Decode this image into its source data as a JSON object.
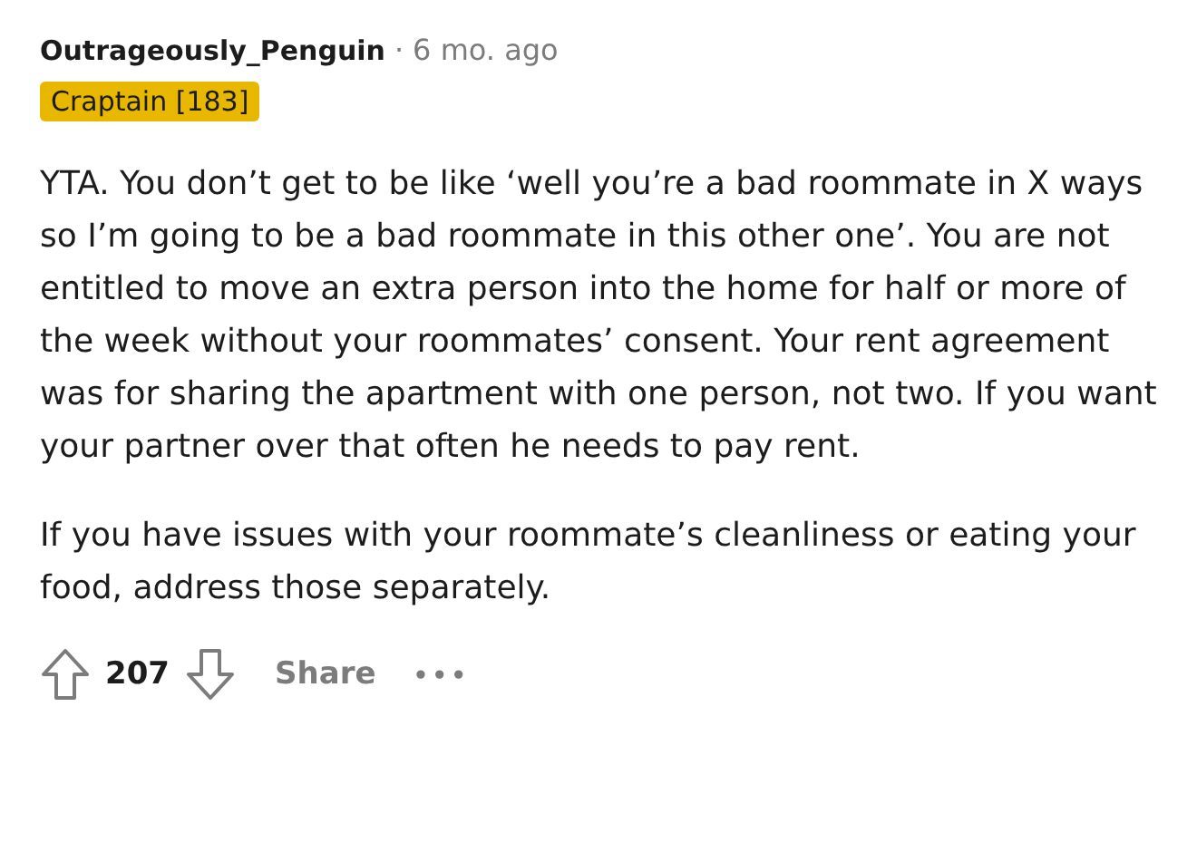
{
  "comment": {
    "author": "Outrageously_Penguin",
    "separator": "·",
    "time": "6 mo. ago",
    "flair": "Craptain [183]",
    "paragraphs": [
      "YTA. You don’t get to be like ‘well you’re a bad roommate in X ways so I’m going to be a bad roommate in this other one’. You are not entitled to move an extra person into the home for half or more of the week without your roommates’ consent. Your rent agreement was for sharing the apartment with one person, not two. If you want your partner over that often he needs to pay rent.",
      "If you have issues with your roommate’s cleanliness or eating your food, address those separately."
    ],
    "score": "207",
    "share": "Share",
    "more": "•••"
  }
}
